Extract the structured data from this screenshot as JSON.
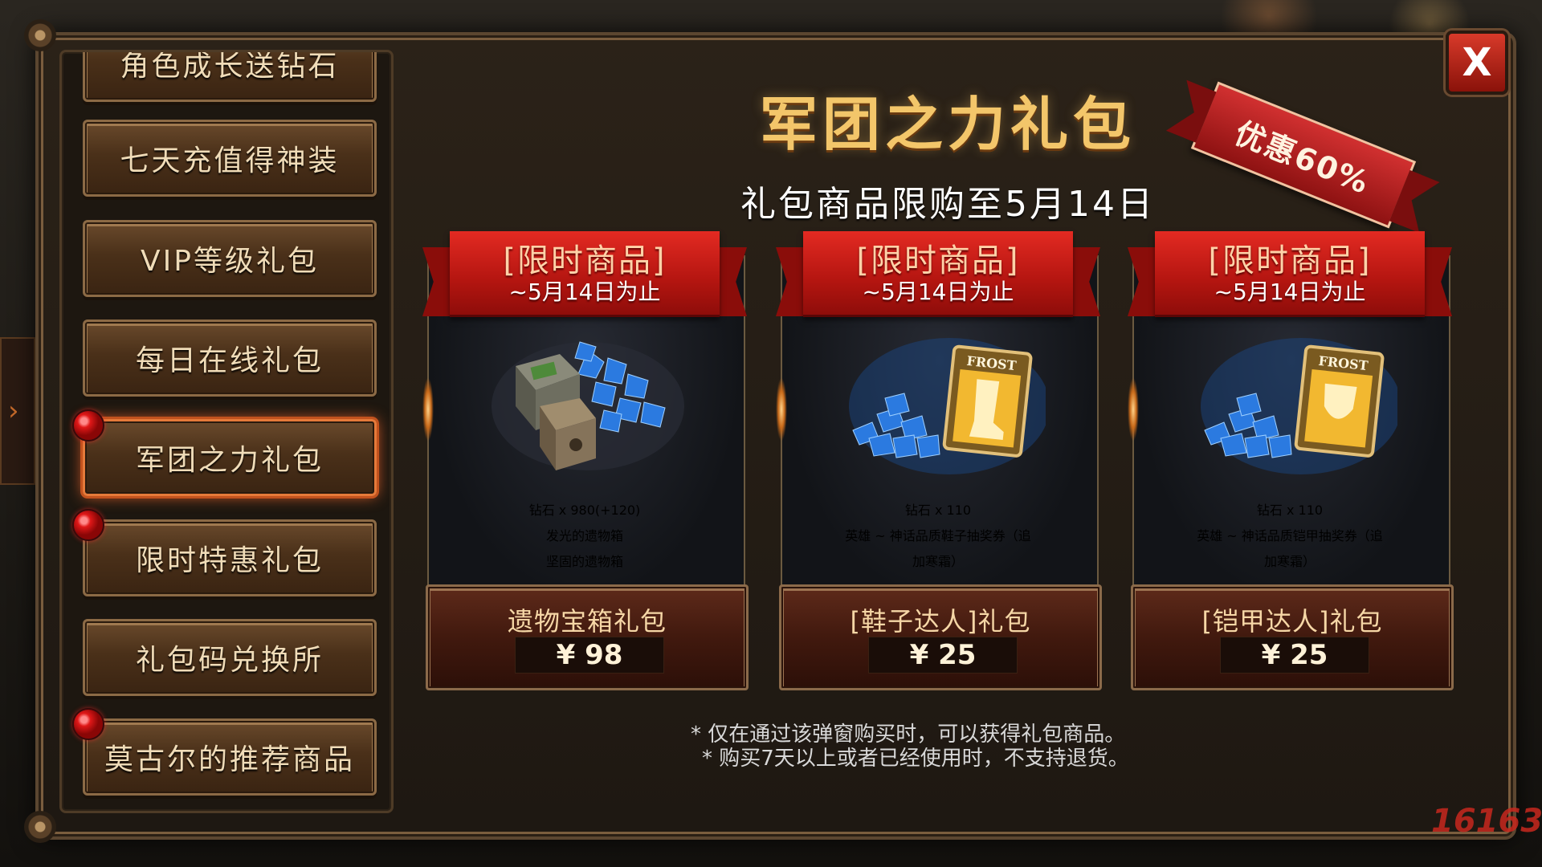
{
  "sidebar": {
    "items": [
      {
        "label": "角色成长送钻石",
        "active": false,
        "badge": false
      },
      {
        "label": "七天充值得神装",
        "active": false,
        "badge": false
      },
      {
        "label": "VIP等级礼包",
        "active": false,
        "badge": false
      },
      {
        "label": "每日在线礼包",
        "active": false,
        "badge": false
      },
      {
        "label": "军团之力礼包",
        "active": true,
        "badge": true
      },
      {
        "label": "限时特惠礼包",
        "active": false,
        "badge": true
      },
      {
        "label": "礼包码兑换所",
        "active": false,
        "badge": false
      },
      {
        "label": "莫古尔的推荐商品",
        "active": false,
        "badge": true
      }
    ]
  },
  "header": {
    "title": "军团之力礼包",
    "subtitle": "礼包商品限购至5月14日",
    "discount": "优惠60%",
    "close_label": "X"
  },
  "cards": [
    {
      "ribbon_title": "[限时商品]",
      "ribbon_sub": "~5月14日为止",
      "reward_main": "钻石 x 980(+120)",
      "reward_lines": [
        "发光的遗物箱",
        "坚固的遗物箱"
      ],
      "package_name": "遗物宝箱礼包",
      "price": "¥  98",
      "art_icon": "relic-box-diamonds-icon"
    },
    {
      "ribbon_title": "[限时商品]",
      "ribbon_sub": "~5月14日为止",
      "reward_main": "钻石 x 110",
      "reward_lines": [
        "英雄 ~ 神话品质鞋子抽奖券（追",
        "加寒霜）"
      ],
      "package_name": "[鞋子达人]礼包",
      "price": "¥  25",
      "art_icon": "frost-boots-ticket-icon",
      "card_label": "FROST"
    },
    {
      "ribbon_title": "[限时商品]",
      "ribbon_sub": "~5月14日为止",
      "reward_main": "钻石 x 110",
      "reward_lines": [
        "英雄 ~ 神话品质铠甲抽奖券（追",
        "加寒霜）"
      ],
      "package_name": "[铠甲达人]礼包",
      "price": "¥  25",
      "art_icon": "frost-armor-ticket-icon",
      "card_label": "FROST"
    }
  ],
  "notes": [
    "* 仅在通过该弹窗购买时，可以获得礼包商品。",
    "* 购买7天以上或者已经使用时，不支持退货。"
  ],
  "watermark": "16163",
  "colors": {
    "title_gold": "#f3c66a",
    "ribbon_red": "#e32a22",
    "badge_red": "#e01818",
    "active_border": "#e57a3a",
    "reward_gold": "#e8b34a"
  }
}
